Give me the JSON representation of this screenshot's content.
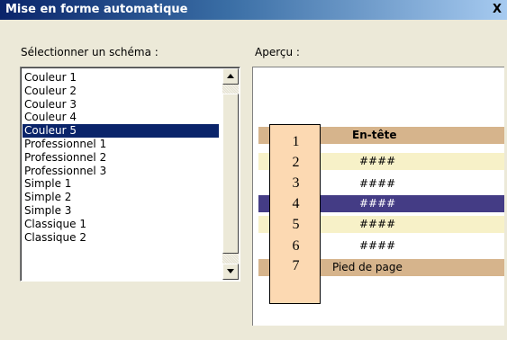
{
  "window": {
    "title": "Mise en forme automatique",
    "close_glyph": "X"
  },
  "labels": {
    "scheme": "Sélectionner un schéma :",
    "preview": "Aperçu :"
  },
  "schemes": [
    {
      "label": "Couleur 1"
    },
    {
      "label": "Couleur 2"
    },
    {
      "label": "Couleur 3"
    },
    {
      "label": "Couleur 4"
    },
    {
      "label": "Couleur 5",
      "selected": true
    },
    {
      "label": "Professionnel 1"
    },
    {
      "label": "Professionnel 2"
    },
    {
      "label": "Professionnel 3"
    },
    {
      "label": "Simple 1"
    },
    {
      "label": "Simple 2"
    },
    {
      "label": "Simple 3"
    },
    {
      "label": "Classique 1"
    },
    {
      "label": "Classique 2"
    }
  ],
  "preview": {
    "header": "En-tête",
    "rows": [
      "####",
      "####",
      "####",
      "####",
      "####"
    ],
    "footer": "Pied de page",
    "row_numbers": [
      "1",
      "2",
      "3",
      "4",
      "5",
      "6",
      "7"
    ]
  },
  "colors": {
    "title_bar": "#0a246a",
    "selection": "#0a246a",
    "preview_header": "#d6b48c",
    "preview_odd_row": "#f7f1c8",
    "preview_selected_row": "#443c85",
    "overlay": "#fcd9b2"
  },
  "icons": {
    "scroll_up": "arrow-up-icon",
    "scroll_down": "arrow-down-icon",
    "close": "close-icon"
  }
}
